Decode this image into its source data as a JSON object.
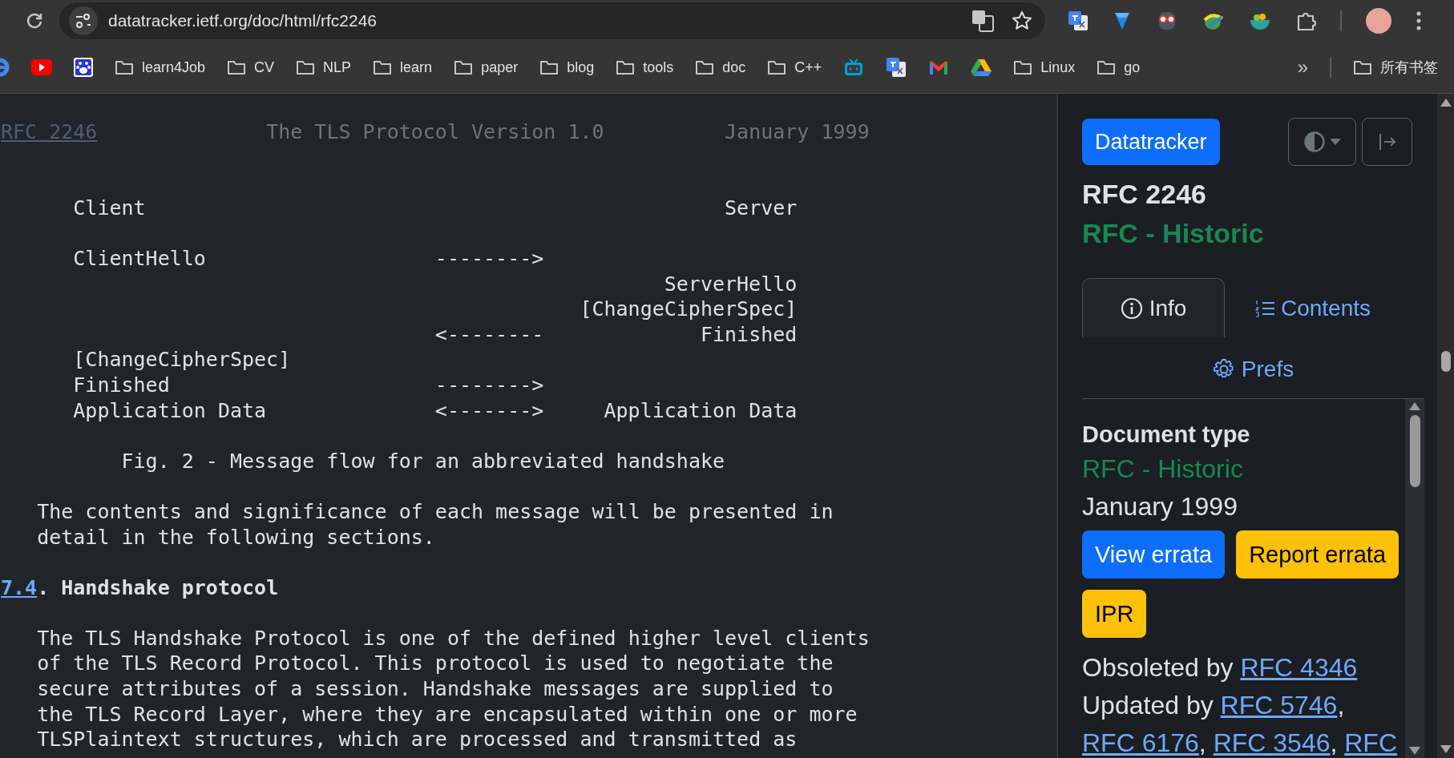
{
  "browser": {
    "url": "datatracker.ietf.org/doc/html/rfc2246",
    "bookmarks": [
      {
        "kind": "site"
      },
      {
        "kind": "site"
      },
      {
        "kind": "site"
      },
      {
        "kind": "folder",
        "label": "learn4Job"
      },
      {
        "kind": "folder",
        "label": "CV"
      },
      {
        "kind": "folder",
        "label": "NLP"
      },
      {
        "kind": "folder",
        "label": "learn"
      },
      {
        "kind": "folder",
        "label": "paper"
      },
      {
        "kind": "folder",
        "label": "blog"
      },
      {
        "kind": "folder",
        "label": "tools"
      },
      {
        "kind": "folder",
        "label": "doc"
      },
      {
        "kind": "folder",
        "label": "C++"
      },
      {
        "kind": "site"
      },
      {
        "kind": "site"
      },
      {
        "kind": "site"
      },
      {
        "kind": "site"
      },
      {
        "kind": "folder",
        "label": "Linux"
      },
      {
        "kind": "folder",
        "label": "go"
      }
    ],
    "more_bookmarks": "»",
    "all_bookmarks": "所有书签"
  },
  "document": {
    "blocks": [
      {
        "kind": "header",
        "link": "RFC 2246",
        "title": "The TLS Protocol Version 1.0",
        "date": "January 1999"
      },
      {
        "kind": "figure",
        "rows": [
          {
            "client": "Client",
            "server": "Server"
          }
        ]
      },
      {
        "kind": "figure",
        "rows": [
          {
            "client": "ClientHello",
            "arrow": "-------->"
          },
          {
            "server": "ServerHello"
          },
          {
            "server": "[ChangeCipherSpec]"
          },
          {
            "arrow": "<--------",
            "server": "Finished"
          },
          {
            "client": "[ChangeCipherSpec]"
          },
          {
            "client": "Finished",
            "arrow": "-------->"
          },
          {
            "client": "Application Data",
            "arrow": "<------->",
            "server": "Application Data"
          }
        ]
      },
      {
        "kind": "caption",
        "text": "Fig. 2 - Message flow for an abbreviated handshake"
      },
      {
        "kind": "paragraph",
        "lines": [
          "The contents and significance of each message will be presented in",
          "detail in the following sections."
        ]
      },
      {
        "kind": "section",
        "number": "7.4",
        "title": ". Handshake protocol"
      },
      {
        "kind": "paragraph",
        "lines": [
          "The TLS Handshake Protocol is one of the defined higher level clients",
          "of the TLS Record Protocol. This protocol is used to negotiate the",
          "secure attributes of a session. Handshake messages are supplied to",
          "the TLS Record Layer, where they are encapsulated within one or more",
          "TLSPlaintext structures, which are processed and transmitted as"
        ]
      }
    ]
  },
  "sidebar": {
    "brand": "Datatracker",
    "title": "RFC 2246",
    "status": "RFC - Historic",
    "tabs": [
      {
        "label": "Info",
        "kind": "info",
        "selected": true
      },
      {
        "label": "Contents",
        "kind": "contents",
        "selected": false
      },
      {
        "label": "Prefs",
        "kind": "prefs",
        "selected": false
      }
    ],
    "document_type": {
      "heading": "Document type",
      "type": "RFC - Historic",
      "date": "January 1999"
    },
    "buttons": [
      {
        "label": "View errata",
        "kind": "primary"
      },
      {
        "label": "Report errata",
        "kind": "warning"
      },
      {
        "label": "IPR",
        "kind": "warning"
      }
    ],
    "relations": [
      {
        "label": "Obsoleted by",
        "links": [
          {
            "text": "RFC 4346"
          }
        ]
      },
      {
        "label": "Updated by",
        "links": [
          {
            "text": "RFC 5746",
            "after": ","
          },
          {
            "text": "RFC 6176",
            "after": ","
          },
          {
            "text": "RFC 3546",
            "after": ","
          },
          {
            "text": "RFC"
          }
        ]
      }
    ]
  }
}
